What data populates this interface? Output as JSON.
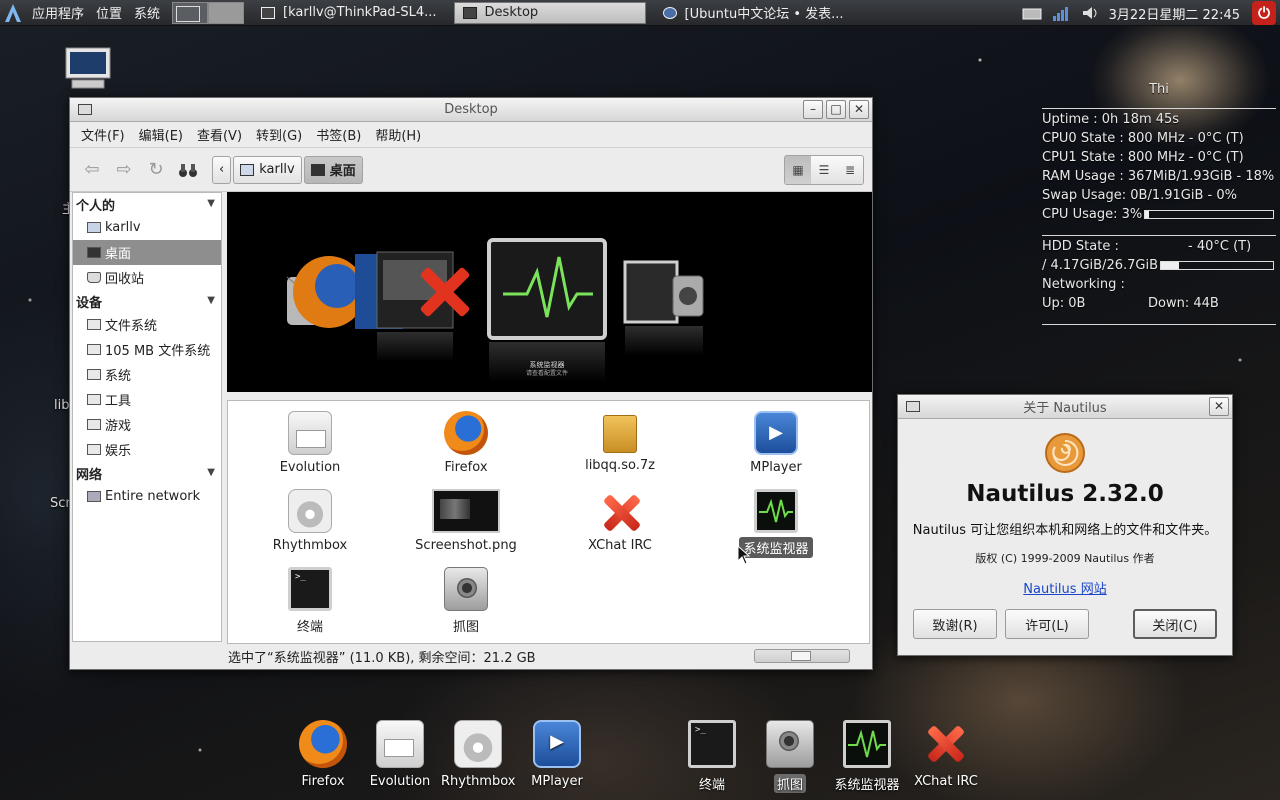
{
  "top_panel": {
    "menus": [
      "应用程序",
      "位置",
      "系统"
    ],
    "tasks": [
      {
        "label": "[karllv@ThinkPad-SL4...",
        "active": false
      },
      {
        "label": "Desktop",
        "active": true
      },
      {
        "label": "[Ubuntu中文论坛 • 发表...",
        "active": false
      }
    ],
    "clock": "3月22日星期二 22:45",
    "icons": [
      "logo-icon",
      "workspace-switcher",
      "network-icon",
      "signal-icon",
      "volume-icon",
      "power-icon"
    ]
  },
  "desktop": {
    "fragments": [
      "lib",
      "Scr",
      "主"
    ]
  },
  "conky": {
    "host": "Thi",
    "uptime": "Uptime : 0h 18m 45s",
    "cpu0": "CPU0 State : 800 MHz - 0°C (T)",
    "cpu1": "CPU1 State : 800 MHz - 0°C (T)",
    "ram": "RAM Usage : 367MiB/1.93GiB - 18%",
    "swap": "Swap Usage: 0B/1.91GiB - 0%",
    "cpu_usage": "CPU Usage: 3%",
    "cpu_usage_level": 0.03,
    "hdd_state": "HDD State :",
    "hdd_temp": "- 40°C (T)",
    "hdd_usage": "/ 4.17GiB/26.7GiB",
    "hdd_usage_level": 0.16,
    "networking": "Networking :",
    "up": "Up: 0B",
    "down": "Down: 44B"
  },
  "nautilus": {
    "title": "Desktop",
    "menus": [
      "文件(F)",
      "编辑(E)",
      "查看(V)",
      "转到(G)",
      "书签(B)",
      "帮助(H)"
    ],
    "path": [
      "karllv",
      "桌面"
    ],
    "sidebar": {
      "personal_header": "个人的",
      "personal": [
        "karllv",
        "桌面",
        "回收站"
      ],
      "devices_header": "设备",
      "devices": [
        "文件系统",
        "105 MB 文件系统",
        "系统",
        "工具",
        "游戏",
        "娱乐"
      ],
      "network_header": "网络",
      "network": [
        "Entire network"
      ]
    },
    "preview": {
      "caption1": "系统监视器",
      "caption2": "请查看配置文件"
    },
    "files": [
      "Evolution",
      "Firefox",
      "libqq.so.7z",
      "MPlayer",
      "Rhythmbox",
      "Screenshot.png",
      "XChat IRC",
      "系统监视器",
      "终端",
      "抓图"
    ],
    "selected": "系统监视器",
    "status": "选中了“系统监视器” (11.0 KB), 剩余空间：21.2 GB"
  },
  "about": {
    "title": "关于 Nautilus",
    "name": "Nautilus 2.32.0",
    "comments": "Nautilus 可让您组织本机和网络上的文件和文件夹。",
    "copyright": "版权 (C) 1999-2009 Nautilus 作者",
    "website": "Nautilus 网站",
    "credits_button": "致谢(R)",
    "license_button": "许可(L)",
    "close_button": "关闭(C)"
  },
  "dock": {
    "items": [
      "Firefox",
      "Evolution",
      "Rhythmbox",
      "MPlayer",
      "终端",
      "抓图",
      "系统监视器",
      "XChat IRC"
    ],
    "active": "抓图"
  }
}
